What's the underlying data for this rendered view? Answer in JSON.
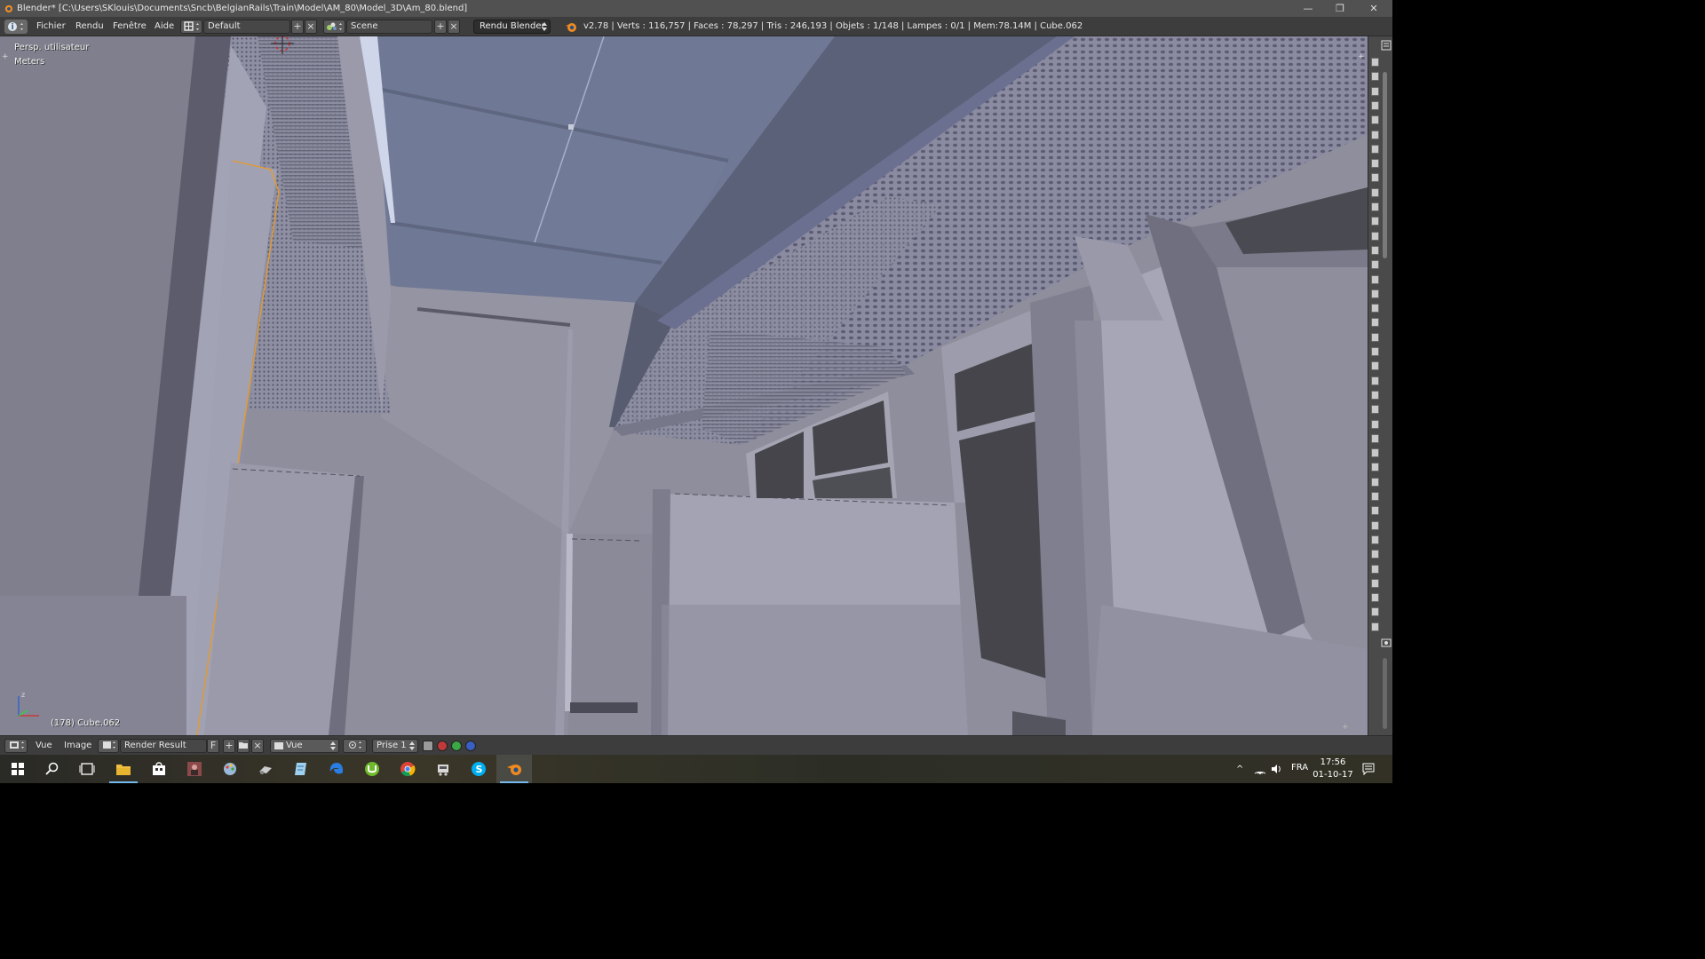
{
  "window": {
    "title": "Blender* [C:\\Users\\SKlouis\\Documents\\Sncb\\BelgianRails\\Train\\Model\\AM_80\\Model_3D\\Am_80.blend]",
    "minimize_glyph": "—",
    "restore_glyph": "❐",
    "close_glyph": "✕"
  },
  "info_header": {
    "menus": [
      "Fichier",
      "Rendu",
      "Fenêtre",
      "Aide"
    ],
    "screen_layout": "Default",
    "scene": "Scene",
    "render_engine": "Rendu Blender",
    "stats": "v2.78 | Verts : 116,757 | Faces : 78,297 | Tris : 246,193 | Objets : 1/148 | Lampes : 0/1 | Mem:78.14M | Cube.062",
    "add_glyph": "+",
    "remove_glyph": "×"
  },
  "viewport": {
    "view_name": "Persp. utilisateur",
    "units": "Meters",
    "active_object": "(178) Cube.062",
    "colors": {
      "background": "#8b8b97",
      "ceiling": "#6f7894",
      "wall_light": "#a6a6b6",
      "wall_mid": "#8f8fa0",
      "panel_dark": "#595965",
      "window": "#45454b",
      "selection_outline": "#e59a2e"
    }
  },
  "image_editor_header": {
    "menus": [
      "Vue",
      "Image"
    ],
    "image_name": "Render Result",
    "fake_user_label": "F",
    "view_mode": "Vue",
    "slot": "Prise 1"
  },
  "taskbar": {
    "icons": [
      "windows-start",
      "search",
      "task-view",
      "file-explorer",
      "store",
      "photo-app",
      "paint-app",
      "game-app",
      "notepad-app",
      "edge",
      "utorrent",
      "chrome",
      "train-sim",
      "skype",
      "blender"
    ],
    "language": "FRA",
    "time": "17:56",
    "date": "01-10-17"
  }
}
